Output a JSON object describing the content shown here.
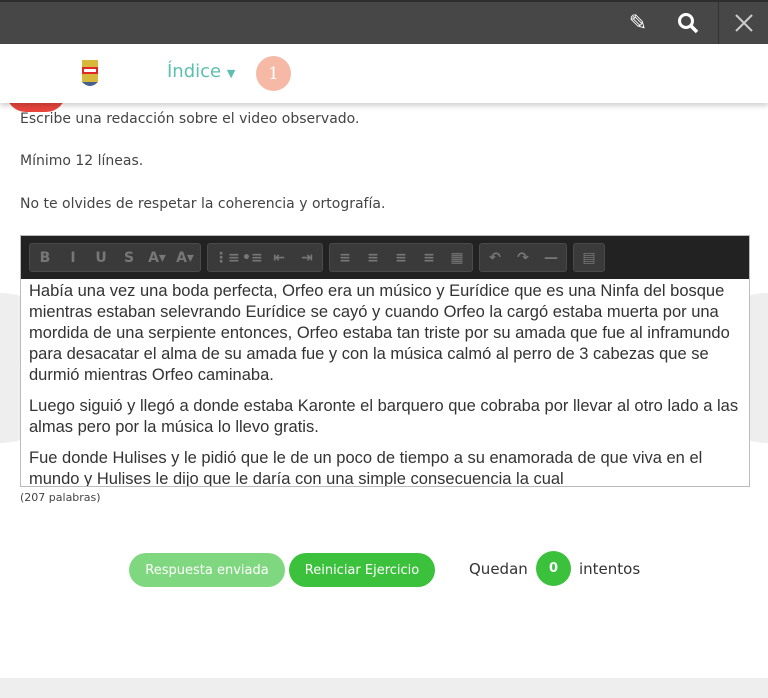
{
  "topbar": {
    "icons": [
      "pencil-icon",
      "search-icon",
      "close-icon"
    ]
  },
  "header": {
    "menu_label": "Índice",
    "page_number": "1"
  },
  "instructions": [
    "Escribe una redacción sobre el video observado.",
    "Mínimo 12 líneas.",
    "No te olvides de respetar la coherencia y ortografía."
  ],
  "toolbar": {
    "groups": [
      [
        "B",
        "I",
        "U",
        "S",
        "A▾",
        "A▾"
      ],
      [
        "⋮≡",
        "•≡",
        "⇤",
        "⇥"
      ],
      [
        "≡",
        "≡",
        "≡",
        "≡",
        "▦"
      ],
      [
        "↶",
        "↷",
        "—"
      ],
      [
        "▤"
      ]
    ]
  },
  "editor": {
    "paragraphs": [
      "Había una vez una boda perfecta, Orfeo era un músico y Eurídice que es una Ninfa del bosque mientras estaban selevrando Eurídice se cayó y cuando Orfeo la cargó estaba muerta por una mordida de una serpiente entonces, Orfeo estaba tan triste por su amada que fue al inframundo para desacatar el alma de su amada fue y con la música calmó al perro de 3 cabezas que se durmió mientras Orfeo caminaba.",
      "Luego siguió y llegó a donde estaba Karonte el barquero que cobraba por llevar al otro lado a las almas pero por la música lo llevo gratis.",
      "Fue donde Hulises y le pidió que le de un poco de tiempo a su enamorada de que viva en el mundo y Hulises le dijo que le daría con una simple consecuencia la cual"
    ],
    "word_count": "(207 palabras)"
  },
  "actions": {
    "sent_label": "Respuesta enviada",
    "restart_label": "Reiniciar Ejercicio",
    "remaining_prefix": "Quedan",
    "remaining_count": "0",
    "remaining_suffix": "intentos"
  },
  "colors": {
    "accent": "#5bbfb0",
    "green": "#3cc13c",
    "green_light": "#7fd87f"
  }
}
